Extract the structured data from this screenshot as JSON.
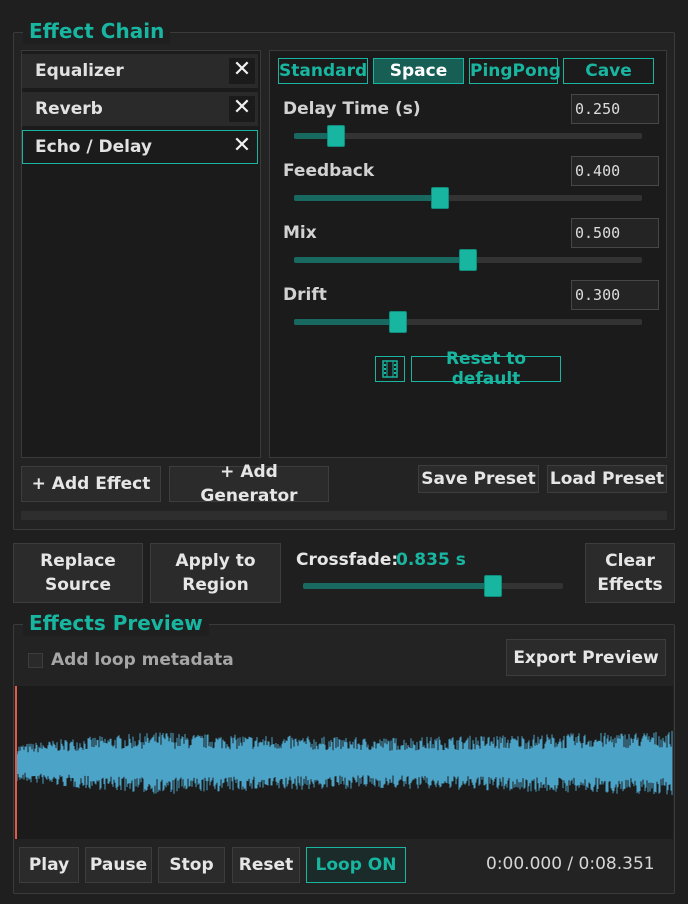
{
  "effect_chain": {
    "title": "Effect Chain",
    "effects": [
      {
        "label": "Equalizer",
        "selected": false
      },
      {
        "label": "Reverb",
        "selected": false
      },
      {
        "label": "Echo / Delay",
        "selected": true
      }
    ],
    "remove_label": "✕",
    "add_effect_label": "+ Add Effect",
    "add_generator_label": "+ Add Generator",
    "save_preset_label": "Save Preset",
    "load_preset_label": "Load Preset"
  },
  "presets": {
    "tabs": [
      "Standard",
      "Space",
      "PingPong",
      "Cave"
    ],
    "active": "Space"
  },
  "params": [
    {
      "label": "Delay Time (s)",
      "value": "0.250",
      "level": 0.12
    },
    {
      "label": "Feedback",
      "value": "0.400",
      "level": 0.42
    },
    {
      "label": "Mix",
      "value": "0.500",
      "level": 0.5
    },
    {
      "label": "Drift",
      "value": "0.300",
      "level": 0.3
    }
  ],
  "reset_label": "Reset to default",
  "actions": {
    "replace_source_line1": "Replace",
    "replace_source_line2": "Source",
    "apply_region_line1": "Apply to",
    "apply_region_line2": "Region",
    "crossfade_label": "Crossfade:",
    "crossfade_value": "0.835 s",
    "crossfade_level": 0.73,
    "clear_line1": "Clear",
    "clear_line2": "Effects"
  },
  "preview": {
    "title": "Effects Preview",
    "loop_metadata_label": "Add loop metadata",
    "loop_metadata_checked": false,
    "export_label": "Export Preview",
    "transport": {
      "play": "Play",
      "pause": "Pause",
      "stop": "Stop",
      "reset": "Reset",
      "loop": "Loop ON"
    },
    "time_display": "0:00.000 / 0:08.351"
  },
  "colors": {
    "accent": "#18b6a0",
    "waveform": "#4ba3c7",
    "playhead": "#e05a4a"
  }
}
